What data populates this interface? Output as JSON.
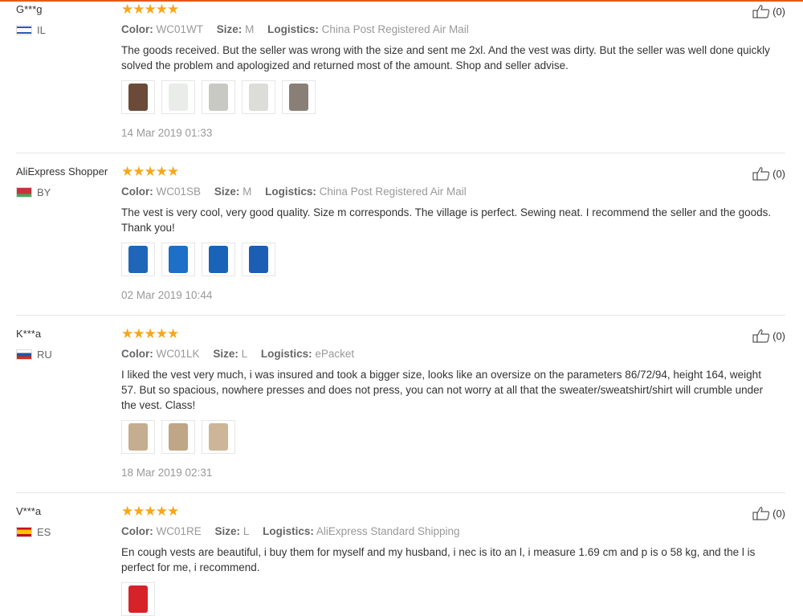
{
  "reviews": [
    {
      "user": "G***g",
      "country": "IL",
      "stars": "★★★★★",
      "color_label": "Color:",
      "color": "WC01WT",
      "size_label": "Size:",
      "size": "M",
      "logistics_label": "Logistics:",
      "logistics": "China Post Registered Air Mail",
      "text": "The goods received. But the seller was wrong with the size and sent me 2xl. And the vest was dirty. But the seller was well done quickly solved the problem and apologized and returned most of the amount. Shop and seller advise.",
      "date": "14 Mar 2019 01:33",
      "likes": "(0)"
    },
    {
      "user": "AliExpress Shopper",
      "country": "BY",
      "stars": "★★★★★",
      "color_label": "Color:",
      "color": "WC01SB",
      "size_label": "Size:",
      "size": "M",
      "logistics_label": "Logistics:",
      "logistics": "China Post Registered Air Mail",
      "text": "The vest is very cool, very good quality. Size m corresponds. The village is perfect. Sewing neat. I recommend the seller and the goods. Thank you!",
      "date": "02 Mar 2019 10:44",
      "likes": "(0)"
    },
    {
      "user": "K***a",
      "country": "RU",
      "stars": "★★★★★",
      "color_label": "Color:",
      "color": "WC01LK",
      "size_label": "Size:",
      "size": "L",
      "logistics_label": "Logistics:",
      "logistics": "ePacket",
      "text": "I liked the vest very much, i was insured and took a bigger size, looks like an oversize on the parameters 86/72/94, height 164, weight 57. But so spacious, nowhere presses and does not press, you can not worry at all that the sweater/sweatshirt/shirt will crumble under the vest. Class!",
      "date": "18 Mar 2019 02:31",
      "likes": "(0)"
    },
    {
      "user": "V***a",
      "country": "ES",
      "stars": "★★★★★",
      "color_label": "Color:",
      "color": "WC01RE",
      "size_label": "Size:",
      "size": "L",
      "logistics_label": "Logistics:",
      "logistics": "AliExpress Standard Shipping",
      "text": "En cough vests are beautiful, i buy them for myself and my husband, i nec is ito an l, i measure 1.69 cm and p is o 58 kg, and the l is perfect for me, i recommend.",
      "likes": "(0)"
    }
  ],
  "thumb_colors": {
    "review1": [
      "#6b4a3a",
      "#e9ece8",
      "#c9c9c4",
      "#dcdcd8",
      "#8a7f77"
    ],
    "review2": [
      "#1f66b8",
      "#1e6fc8",
      "#1b63b9",
      "#1a5fb3"
    ],
    "review3": [
      "#c5ad8f",
      "#bfa686",
      "#cdb597"
    ],
    "review4": [
      "#d6232a"
    ]
  },
  "icons": {
    "like": "thumbs-up-icon",
    "star": "star-icon"
  },
  "colors": {
    "accent": "#e7591b",
    "star": "#f7a71a",
    "divider": "#e8e8e8"
  }
}
